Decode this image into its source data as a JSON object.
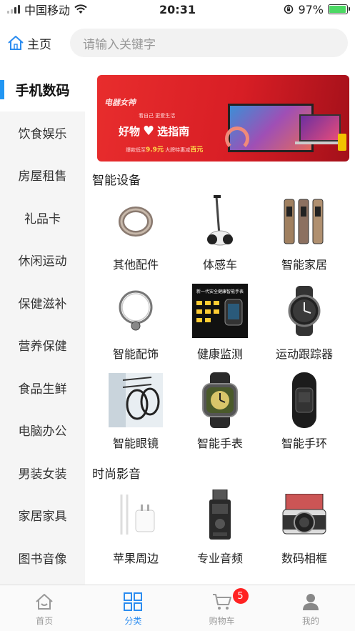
{
  "status": {
    "carrier": "中国移动",
    "time": "20:31",
    "battery": "97%",
    "battery_level": 0.97
  },
  "header": {
    "home_label": "主页",
    "search_placeholder": "请输入关键字"
  },
  "sidebar": {
    "items": [
      {
        "label": "手机数码",
        "active": true
      },
      {
        "label": "饮食娱乐"
      },
      {
        "label": "房屋租售"
      },
      {
        "label": "礼品卡"
      },
      {
        "label": "休闲运动"
      },
      {
        "label": "保健滋补"
      },
      {
        "label": "营养保健"
      },
      {
        "label": "食品生鲜"
      },
      {
        "label": "电脑办公"
      },
      {
        "label": "男装女装"
      },
      {
        "label": "家居家具"
      },
      {
        "label": "图书音像"
      }
    ]
  },
  "banner": {
    "brand": "电器女神",
    "subline": "看自己  更爱生活",
    "headline_left": "好物",
    "headline_right": "选指南",
    "promo_prefix": "爆款低至",
    "promo_price": "9.9元",
    "promo_mid": "大牌特惠减",
    "promo_suffix": "百元"
  },
  "sections": [
    {
      "title": "智能设备",
      "items": [
        {
          "label": "其他配件",
          "icon": "smart-ring-icon"
        },
        {
          "label": "体感车",
          "icon": "balance-scooter-icon"
        },
        {
          "label": "智能家居",
          "icon": "smart-door-lock-icon"
        },
        {
          "label": "智能配饰",
          "icon": "smart-necklace-icon"
        },
        {
          "label": "健康监测",
          "icon": "health-monitor-icon",
          "banner_text": "新一代安全健康智能手表"
        },
        {
          "label": "运动跟踪器",
          "icon": "sport-tracker-icon"
        },
        {
          "label": "智能眼镜",
          "icon": "smart-glasses-icon"
        },
        {
          "label": "智能手表",
          "icon": "smart-watch-icon"
        },
        {
          "label": "智能手环",
          "icon": "smart-band-icon"
        }
      ]
    },
    {
      "title": "时尚影音",
      "items": [
        {
          "label": "苹果周边",
          "icon": "apple-charger-icon"
        },
        {
          "label": "专业音频",
          "icon": "audio-recorder-icon"
        },
        {
          "label": "数码相框",
          "icon": "digital-camera-icon"
        }
      ]
    }
  ],
  "tabbar": {
    "tabs": [
      {
        "label": "首页",
        "icon": "home-icon"
      },
      {
        "label": "分类",
        "icon": "category-icon",
        "active": true
      },
      {
        "label": "购物车",
        "icon": "cart-icon",
        "badge": "5"
      },
      {
        "label": "我的",
        "icon": "profile-icon"
      }
    ]
  },
  "colors": {
    "accent": "#2b8cf0",
    "sidebar_indicator": "#2196f3",
    "badge": "#ff2222",
    "banner_red": "#e82d2d"
  }
}
